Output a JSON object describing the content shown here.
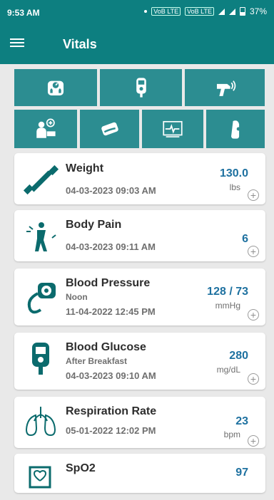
{
  "status": {
    "time": "9:53 AM",
    "battery": "37%",
    "mini1": "VoB LTE",
    "mini2": "VoB LTE"
  },
  "appbar": {
    "title": "Vitals"
  },
  "tiles": [
    {
      "name": "weight-scale-tile",
      "icon": "weight-scale-icon"
    },
    {
      "name": "glucose-meter-tile",
      "icon": "glucose-meter-icon"
    },
    {
      "name": "thermometer-tile",
      "icon": "thermometer-icon"
    },
    {
      "name": "doctor-tile",
      "icon": "doctor-icon"
    },
    {
      "name": "pulse-oximeter-tile",
      "icon": "pulse-oximeter-icon"
    },
    {
      "name": "ecg-monitor-tile",
      "icon": "ecg-monitor-icon"
    },
    {
      "name": "spirometer-tile",
      "icon": "spirometer-icon"
    }
  ],
  "vitals": [
    {
      "title": "Weight",
      "subtitle": "",
      "date": "04-03-2023 09:03 AM",
      "value": "130.0",
      "unit": "lbs",
      "icon": "dumbbell-icon"
    },
    {
      "title": "Body Pain",
      "subtitle": "",
      "date": "04-03-2023 09:11 AM",
      "value": "6",
      "unit": "",
      "icon": "body-pain-icon"
    },
    {
      "title": "Blood Pressure",
      "subtitle": "Noon",
      "date": "11-04-2022 12:45 PM",
      "value": "128 / 73",
      "unit": "mmHg",
      "icon": "blood-pressure-icon"
    },
    {
      "title": "Blood Glucose",
      "subtitle": "After Breakfast",
      "date": "04-03-2023 09:10 AM",
      "value": "280",
      "unit": "mg/dL",
      "icon": "glucose-meter-icon"
    },
    {
      "title": "Respiration Rate",
      "subtitle": "",
      "date": "05-01-2022 12:02 PM",
      "value": "23",
      "unit": "bpm",
      "icon": "lungs-icon"
    },
    {
      "title": "SpO2",
      "subtitle": "",
      "date": "",
      "value": "97",
      "unit": "",
      "icon": "spo2-icon"
    }
  ],
  "colors": {
    "primary": "#0d7f80",
    "tile": "#2c8d91",
    "value": "#1e71a0"
  }
}
